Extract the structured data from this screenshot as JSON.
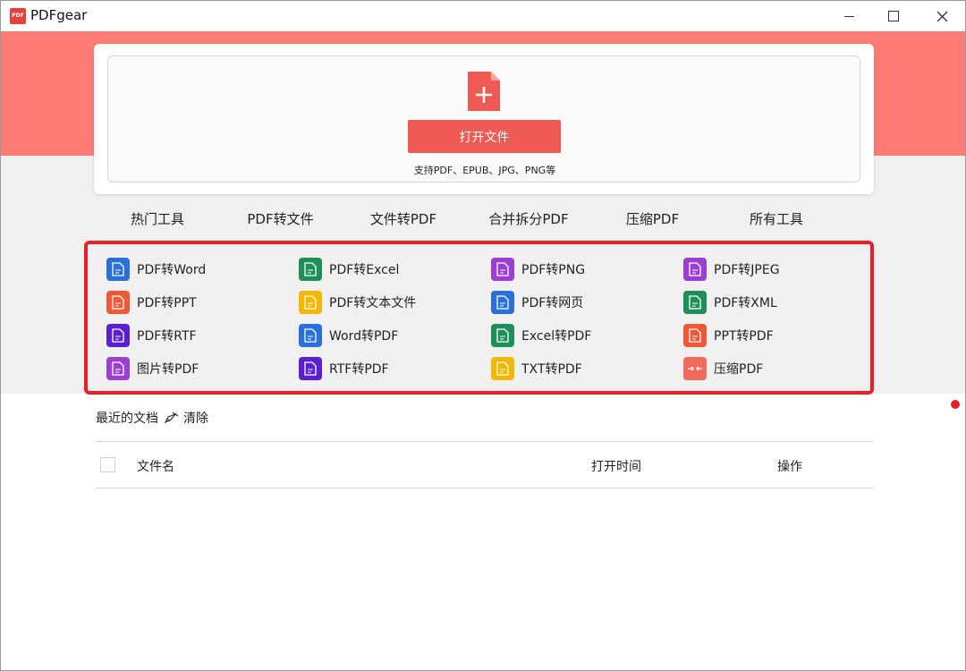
{
  "window": {
    "app_logo_text": "PDF",
    "title": "PDFgear",
    "controls": [
      "minimize-icon",
      "maximize-icon",
      "close-icon"
    ]
  },
  "colors": {
    "brand": "#ef5b54",
    "header_band": "#fe7b76",
    "highlight_border": "#ee1c25"
  },
  "open_area": {
    "icon": "add-file-icon",
    "button_label": "打开文件",
    "support_text": "支持PDF、EPUB、JPG、PNG等"
  },
  "tabs": [
    {
      "label": "热门工具",
      "active": false
    },
    {
      "label": "PDF转文件",
      "active": false
    },
    {
      "label": "文件转PDF",
      "active": false
    },
    {
      "label": "合并拆分PDF",
      "active": false
    },
    {
      "label": "压缩PDF",
      "active": false
    },
    {
      "label": "所有工具",
      "active": true
    }
  ],
  "tools": [
    {
      "label": "PDF转Word",
      "icon": "pdf-to-word-icon",
      "color": "#2b6fd8"
    },
    {
      "label": "PDF转Excel",
      "icon": "pdf-to-excel-icon",
      "color": "#1f8f5a"
    },
    {
      "label": "PDF转PNG",
      "icon": "pdf-to-png-icon",
      "color": "#9b3fd1"
    },
    {
      "label": "PDF转JPEG",
      "icon": "pdf-to-jpeg-icon",
      "color": "#9b3fd1"
    },
    {
      "label": "PDF转PPT",
      "icon": "pdf-to-ppt-icon",
      "color": "#ee5a38"
    },
    {
      "label": "PDF转文本文件",
      "icon": "pdf-to-text-icon",
      "color": "#f5b800"
    },
    {
      "label": "PDF转网页",
      "icon": "pdf-to-html-icon",
      "color": "#2b6fd8"
    },
    {
      "label": "PDF转XML",
      "icon": "pdf-to-xml-icon",
      "color": "#1f8f5a"
    },
    {
      "label": "PDF转RTF",
      "icon": "pdf-to-rtf-icon",
      "color": "#5a1fd1"
    },
    {
      "label": "Word转PDF",
      "icon": "word-to-pdf-icon",
      "color": "#2b6fd8"
    },
    {
      "label": "Excel转PDF",
      "icon": "excel-to-pdf-icon",
      "color": "#1f8f5a"
    },
    {
      "label": "PPT转PDF",
      "icon": "ppt-to-pdf-icon",
      "color": "#ee5a38"
    },
    {
      "label": "图片转PDF",
      "icon": "image-to-pdf-icon",
      "color": "#9b3fd1"
    },
    {
      "label": "RTF转PDF",
      "icon": "rtf-to-pdf-icon",
      "color": "#5a1fd1"
    },
    {
      "label": "TXT转PDF",
      "icon": "txt-to-pdf-icon",
      "color": "#f5b800"
    },
    {
      "label": "压缩PDF",
      "icon": "compress-pdf-icon",
      "color": "#f26a5c"
    }
  ],
  "recent": {
    "title": "最近的文档",
    "clear_label": "清除",
    "columns": {
      "name": "文件名",
      "time": "打开时间",
      "ops": "操作"
    }
  }
}
